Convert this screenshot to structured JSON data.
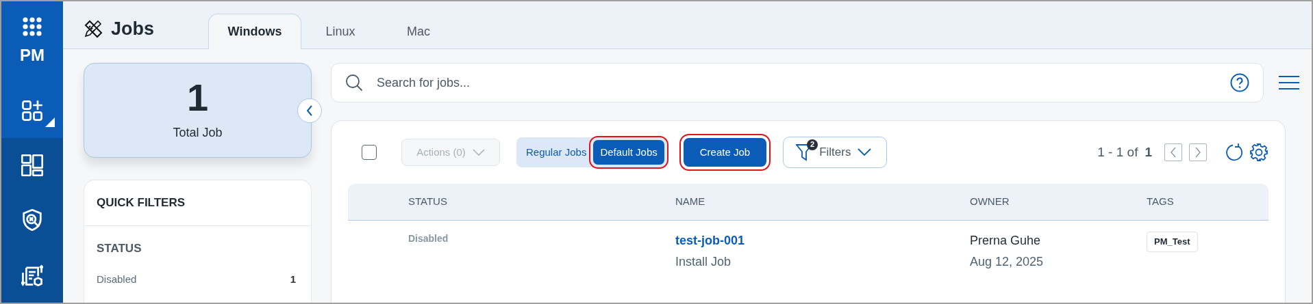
{
  "app": {
    "label": "PM"
  },
  "sidebar": {
    "items": [
      {
        "kind": "widgets",
        "selected": true
      },
      {
        "kind": "dashboard",
        "selected": false
      },
      {
        "kind": "shield",
        "selected": false
      },
      {
        "kind": "deploy",
        "selected": false
      }
    ]
  },
  "page": {
    "title": "Jobs"
  },
  "tabs": [
    {
      "label": "Windows",
      "selected": true
    },
    {
      "label": "Linux",
      "selected": false
    },
    {
      "label": "Mac",
      "selected": false
    }
  ],
  "summary": {
    "count": "1",
    "label": "Total Job"
  },
  "quick_filters": {
    "title": "QUICK FILTERS",
    "sections": [
      {
        "title": "STATUS",
        "items": [
          {
            "label": "Disabled",
            "count": "1"
          }
        ]
      }
    ]
  },
  "search": {
    "placeholder": "Search for jobs..."
  },
  "toolbar": {
    "select_all": {
      "checked": false
    },
    "actions": {
      "label": "Actions (0)",
      "disabled": true
    },
    "job_types": [
      {
        "label": "Regular Jobs",
        "selected": false,
        "highlighted": false
      },
      {
        "label": "Default Jobs",
        "selected": true,
        "highlighted": true
      }
    ],
    "create": {
      "label": "Create Job",
      "highlighted": true
    },
    "filters": {
      "label": "Filters",
      "count": "2"
    },
    "pagination": {
      "range": "1 - 1 of",
      "total": "1"
    }
  },
  "table": {
    "columns": [
      "STATUS",
      "NAME",
      "OWNER",
      "TAGS"
    ],
    "rows": [
      {
        "status": "Disabled",
        "name": "test-job-001",
        "type": "Install Job",
        "owner": "Prerna Guhe",
        "date": "Aug 12, 2025",
        "tags": [
          "PM_Test"
        ]
      }
    ]
  }
}
